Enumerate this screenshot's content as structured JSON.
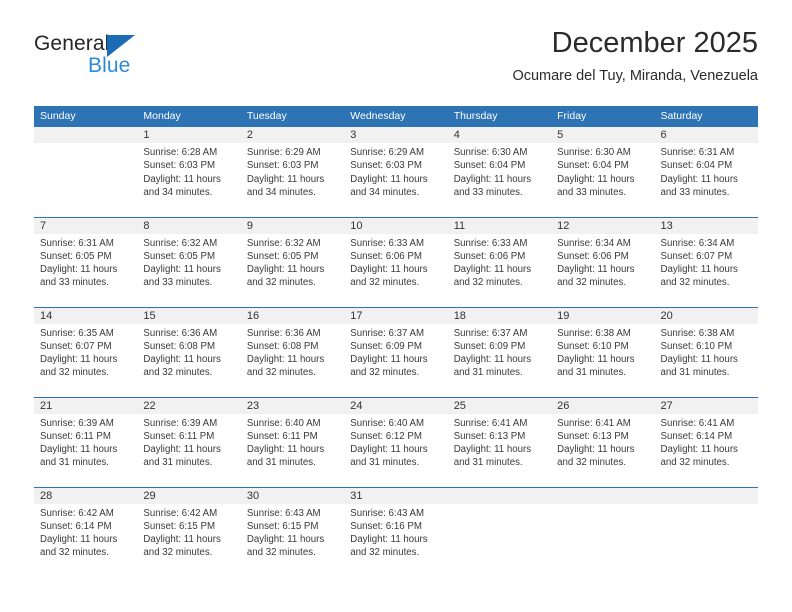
{
  "brand": {
    "name_part1": "General",
    "name_part2": "Blue",
    "triangle_color": "#1B6BB5",
    "blue_text_color": "#2E8BD8"
  },
  "header": {
    "title": "December 2025",
    "subtitle": "Ocumare del Tuy, Miranda, Venezuela"
  },
  "theme": {
    "header_blue": "#2E74B5",
    "daynum_band": "#f1f1f1",
    "text": "#333333"
  },
  "weekdays": [
    "Sunday",
    "Monday",
    "Tuesday",
    "Wednesday",
    "Thursday",
    "Friday",
    "Saturday"
  ],
  "weeks": [
    [
      {
        "day": "",
        "empty": true,
        "sunrise": "",
        "sunset": "",
        "daylight_line1": "",
        "daylight_line2": ""
      },
      {
        "day": "1",
        "sunrise": "Sunrise: 6:28 AM",
        "sunset": "Sunset: 6:03 PM",
        "daylight_line1": "Daylight: 11 hours",
        "daylight_line2": "and 34 minutes."
      },
      {
        "day": "2",
        "sunrise": "Sunrise: 6:29 AM",
        "sunset": "Sunset: 6:03 PM",
        "daylight_line1": "Daylight: 11 hours",
        "daylight_line2": "and 34 minutes."
      },
      {
        "day": "3",
        "sunrise": "Sunrise: 6:29 AM",
        "sunset": "Sunset: 6:03 PM",
        "daylight_line1": "Daylight: 11 hours",
        "daylight_line2": "and 34 minutes."
      },
      {
        "day": "4",
        "sunrise": "Sunrise: 6:30 AM",
        "sunset": "Sunset: 6:04 PM",
        "daylight_line1": "Daylight: 11 hours",
        "daylight_line2": "and 33 minutes."
      },
      {
        "day": "5",
        "sunrise": "Sunrise: 6:30 AM",
        "sunset": "Sunset: 6:04 PM",
        "daylight_line1": "Daylight: 11 hours",
        "daylight_line2": "and 33 minutes."
      },
      {
        "day": "6",
        "sunrise": "Sunrise: 6:31 AM",
        "sunset": "Sunset: 6:04 PM",
        "daylight_line1": "Daylight: 11 hours",
        "daylight_line2": "and 33 minutes."
      }
    ],
    [
      {
        "day": "7",
        "sunrise": "Sunrise: 6:31 AM",
        "sunset": "Sunset: 6:05 PM",
        "daylight_line1": "Daylight: 11 hours",
        "daylight_line2": "and 33 minutes."
      },
      {
        "day": "8",
        "sunrise": "Sunrise: 6:32 AM",
        "sunset": "Sunset: 6:05 PM",
        "daylight_line1": "Daylight: 11 hours",
        "daylight_line2": "and 33 minutes."
      },
      {
        "day": "9",
        "sunrise": "Sunrise: 6:32 AM",
        "sunset": "Sunset: 6:05 PM",
        "daylight_line1": "Daylight: 11 hours",
        "daylight_line2": "and 32 minutes."
      },
      {
        "day": "10",
        "sunrise": "Sunrise: 6:33 AM",
        "sunset": "Sunset: 6:06 PM",
        "daylight_line1": "Daylight: 11 hours",
        "daylight_line2": "and 32 minutes."
      },
      {
        "day": "11",
        "sunrise": "Sunrise: 6:33 AM",
        "sunset": "Sunset: 6:06 PM",
        "daylight_line1": "Daylight: 11 hours",
        "daylight_line2": "and 32 minutes."
      },
      {
        "day": "12",
        "sunrise": "Sunrise: 6:34 AM",
        "sunset": "Sunset: 6:06 PM",
        "daylight_line1": "Daylight: 11 hours",
        "daylight_line2": "and 32 minutes."
      },
      {
        "day": "13",
        "sunrise": "Sunrise: 6:34 AM",
        "sunset": "Sunset: 6:07 PM",
        "daylight_line1": "Daylight: 11 hours",
        "daylight_line2": "and 32 minutes."
      }
    ],
    [
      {
        "day": "14",
        "sunrise": "Sunrise: 6:35 AM",
        "sunset": "Sunset: 6:07 PM",
        "daylight_line1": "Daylight: 11 hours",
        "daylight_line2": "and 32 minutes."
      },
      {
        "day": "15",
        "sunrise": "Sunrise: 6:36 AM",
        "sunset": "Sunset: 6:08 PM",
        "daylight_line1": "Daylight: 11 hours",
        "daylight_line2": "and 32 minutes."
      },
      {
        "day": "16",
        "sunrise": "Sunrise: 6:36 AM",
        "sunset": "Sunset: 6:08 PM",
        "daylight_line1": "Daylight: 11 hours",
        "daylight_line2": "and 32 minutes."
      },
      {
        "day": "17",
        "sunrise": "Sunrise: 6:37 AM",
        "sunset": "Sunset: 6:09 PM",
        "daylight_line1": "Daylight: 11 hours",
        "daylight_line2": "and 32 minutes."
      },
      {
        "day": "18",
        "sunrise": "Sunrise: 6:37 AM",
        "sunset": "Sunset: 6:09 PM",
        "daylight_line1": "Daylight: 11 hours",
        "daylight_line2": "and 31 minutes."
      },
      {
        "day": "19",
        "sunrise": "Sunrise: 6:38 AM",
        "sunset": "Sunset: 6:10 PM",
        "daylight_line1": "Daylight: 11 hours",
        "daylight_line2": "and 31 minutes."
      },
      {
        "day": "20",
        "sunrise": "Sunrise: 6:38 AM",
        "sunset": "Sunset: 6:10 PM",
        "daylight_line1": "Daylight: 11 hours",
        "daylight_line2": "and 31 minutes."
      }
    ],
    [
      {
        "day": "21",
        "sunrise": "Sunrise: 6:39 AM",
        "sunset": "Sunset: 6:11 PM",
        "daylight_line1": "Daylight: 11 hours",
        "daylight_line2": "and 31 minutes."
      },
      {
        "day": "22",
        "sunrise": "Sunrise: 6:39 AM",
        "sunset": "Sunset: 6:11 PM",
        "daylight_line1": "Daylight: 11 hours",
        "daylight_line2": "and 31 minutes."
      },
      {
        "day": "23",
        "sunrise": "Sunrise: 6:40 AM",
        "sunset": "Sunset: 6:11 PM",
        "daylight_line1": "Daylight: 11 hours",
        "daylight_line2": "and 31 minutes."
      },
      {
        "day": "24",
        "sunrise": "Sunrise: 6:40 AM",
        "sunset": "Sunset: 6:12 PM",
        "daylight_line1": "Daylight: 11 hours",
        "daylight_line2": "and 31 minutes."
      },
      {
        "day": "25",
        "sunrise": "Sunrise: 6:41 AM",
        "sunset": "Sunset: 6:13 PM",
        "daylight_line1": "Daylight: 11 hours",
        "daylight_line2": "and 31 minutes."
      },
      {
        "day": "26",
        "sunrise": "Sunrise: 6:41 AM",
        "sunset": "Sunset: 6:13 PM",
        "daylight_line1": "Daylight: 11 hours",
        "daylight_line2": "and 32 minutes."
      },
      {
        "day": "27",
        "sunrise": "Sunrise: 6:41 AM",
        "sunset": "Sunset: 6:14 PM",
        "daylight_line1": "Daylight: 11 hours",
        "daylight_line2": "and 32 minutes."
      }
    ],
    [
      {
        "day": "28",
        "sunrise": "Sunrise: 6:42 AM",
        "sunset": "Sunset: 6:14 PM",
        "daylight_line1": "Daylight: 11 hours",
        "daylight_line2": "and 32 minutes."
      },
      {
        "day": "29",
        "sunrise": "Sunrise: 6:42 AM",
        "sunset": "Sunset: 6:15 PM",
        "daylight_line1": "Daylight: 11 hours",
        "daylight_line2": "and 32 minutes."
      },
      {
        "day": "30",
        "sunrise": "Sunrise: 6:43 AM",
        "sunset": "Sunset: 6:15 PM",
        "daylight_line1": "Daylight: 11 hours",
        "daylight_line2": "and 32 minutes."
      },
      {
        "day": "31",
        "sunrise": "Sunrise: 6:43 AM",
        "sunset": "Sunset: 6:16 PM",
        "daylight_line1": "Daylight: 11 hours",
        "daylight_line2": "and 32 minutes."
      },
      {
        "day": "",
        "empty": true,
        "sunrise": "",
        "sunset": "",
        "daylight_line1": "",
        "daylight_line2": ""
      },
      {
        "day": "",
        "empty": true,
        "sunrise": "",
        "sunset": "",
        "daylight_line1": "",
        "daylight_line2": ""
      },
      {
        "day": "",
        "empty": true,
        "sunrise": "",
        "sunset": "",
        "daylight_line1": "",
        "daylight_line2": ""
      }
    ]
  ]
}
